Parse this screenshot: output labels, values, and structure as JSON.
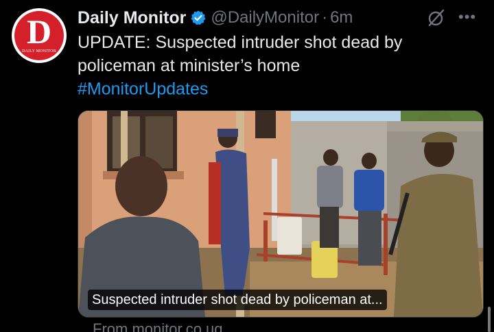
{
  "account": {
    "name": "Daily Monitor",
    "handle": "@DailyMonitor",
    "separator": "·",
    "time": "6m",
    "avatar_letter": "D",
    "avatar_brand": "DAILY MONITOR",
    "verified_color": "#1d9bf0"
  },
  "tweet": {
    "line1": "UPDATE: Suspected intruder shot dead by",
    "line2": "policeman at minister’s home",
    "hashtag": "#MonitorUpdates"
  },
  "media": {
    "caption": "Suspected intruder shot dead by policeman at..."
  },
  "card": {
    "source": "From monitor.co.ug"
  },
  "icons": {
    "grok": "grok-icon",
    "more": "more-options-icon",
    "verified": "verified-badge-icon"
  },
  "colors": {
    "background": "#000000",
    "text": "#e7e9ea",
    "muted": "#71767b",
    "link": "#1d9bf0",
    "brand_red": "#d4202a"
  }
}
